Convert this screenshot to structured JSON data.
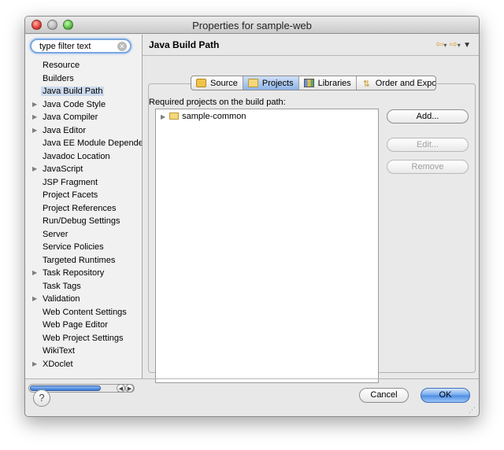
{
  "window": {
    "title": "Properties for sample-web"
  },
  "sidebar": {
    "filter_value": "type filter text",
    "items": [
      {
        "label": "Resource",
        "expandable": false
      },
      {
        "label": "Builders",
        "expandable": false
      },
      {
        "label": "Java Build Path",
        "expandable": false,
        "selected": true
      },
      {
        "label": "Java Code Style",
        "expandable": true
      },
      {
        "label": "Java Compiler",
        "expandable": true
      },
      {
        "label": "Java Editor",
        "expandable": true
      },
      {
        "label": "Java EE Module Dependen",
        "expandable": false
      },
      {
        "label": "Javadoc Location",
        "expandable": false
      },
      {
        "label": "JavaScript",
        "expandable": true
      },
      {
        "label": "JSP Fragment",
        "expandable": false
      },
      {
        "label": "Project Facets",
        "expandable": false
      },
      {
        "label": "Project References",
        "expandable": false
      },
      {
        "label": "Run/Debug Settings",
        "expandable": false
      },
      {
        "label": "Server",
        "expandable": false
      },
      {
        "label": "Service Policies",
        "expandable": false
      },
      {
        "label": "Targeted Runtimes",
        "expandable": false
      },
      {
        "label": "Task Repository",
        "expandable": true
      },
      {
        "label": "Task Tags",
        "expandable": false
      },
      {
        "label": "Validation",
        "expandable": true
      },
      {
        "label": "Web Content Settings",
        "expandable": false
      },
      {
        "label": "Web Page Editor",
        "expandable": false
      },
      {
        "label": "Web Project Settings",
        "expandable": false
      },
      {
        "label": "WikiText",
        "expandable": false
      },
      {
        "label": "XDoclet",
        "expandable": true
      }
    ]
  },
  "main": {
    "page_title": "Java Build Path",
    "tabs": [
      {
        "label": "Source",
        "icon": "source-icon",
        "active": false
      },
      {
        "label": "Projects",
        "icon": "folder-icon",
        "active": true
      },
      {
        "label": "Libraries",
        "icon": "libraries-icon",
        "active": false
      },
      {
        "label": "Order and Export",
        "icon": "order-export-icon",
        "active": false
      }
    ],
    "required_label": "Required projects on the build path:",
    "projects": [
      {
        "label": "sample-common"
      }
    ],
    "buttons": {
      "add": "Add...",
      "edit": "Edit...",
      "remove": "Remove"
    }
  },
  "footer": {
    "help": "?",
    "cancel": "Cancel",
    "ok": "OK"
  },
  "colors": {
    "accent": "#4b8ce3",
    "selection": "#cbd9ec",
    "window_bg": "#e8e8e8"
  }
}
